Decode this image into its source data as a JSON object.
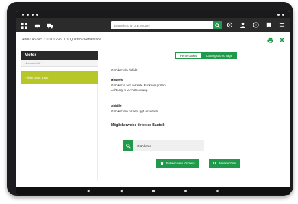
{
  "search": {
    "placeholder": "Bauteilsuche (z.B. Motor)"
  },
  "breadcrumb": "Audi / A5 / A5 3.0 TDI 2.4V TDI Quattro / Fehlercode",
  "left": {
    "header": "Motor",
    "subheader": "Motorelektrik 1",
    "selected": "Fehlercode: 4587"
  },
  "tabs": [
    "Fehlercodes",
    "Lösungsvorschläge"
  ],
  "content": {
    "line1": "Glühkerze/n defekt.",
    "h1": "Hinweis",
    "p1a": "Glühkerze auf korrekte Funktion prüfen.",
    "p1b": "Achtung! 5 V Ansteuerung",
    "h2": "Abhilfe",
    "p2": "Glühkerze/n prüfen, ggf. ersetzen.",
    "h3": "Möglicherweise defektes Bauteil:",
    "part": "Glühkerze",
    "btn1": "Fehlercodes löschen",
    "btn2": "Messtechnik"
  },
  "colors": {
    "accent": "#1f9a4a",
    "selected": "#b7c72a",
    "dark": "#2b2b2b"
  }
}
